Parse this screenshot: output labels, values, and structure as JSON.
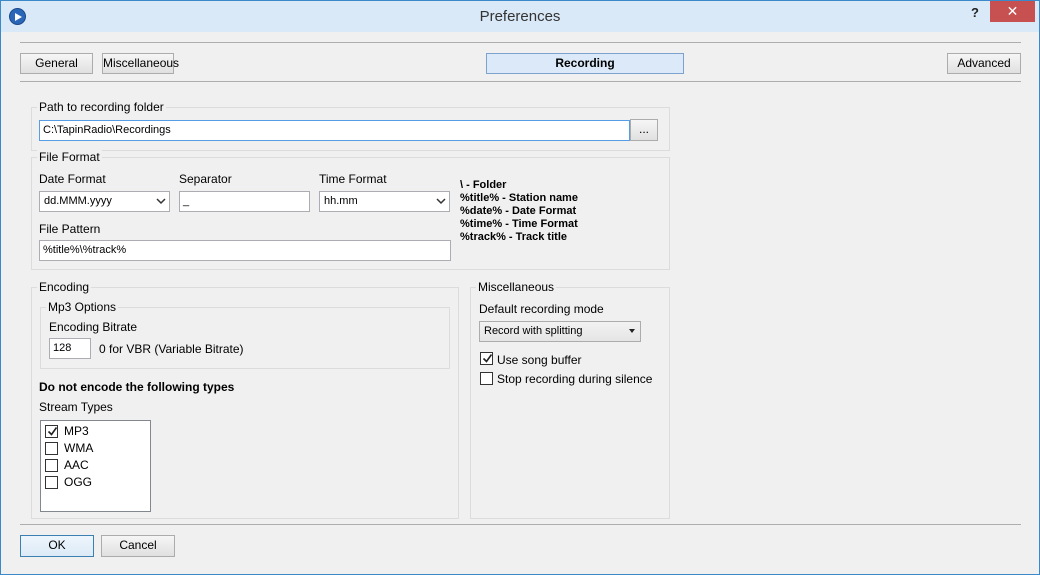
{
  "window": {
    "title": "Preferences",
    "help": "?",
    "close": "✕"
  },
  "tabs": [
    {
      "label": "General"
    },
    {
      "label": "Miscellaneous"
    },
    {
      "label": "Recording"
    },
    {
      "label": "Advanced"
    }
  ],
  "path": {
    "group_label": "Path to recording folder",
    "value": "C:\\TapinRadio\\Recordings",
    "browse": "..."
  },
  "file_format": {
    "group_label": "File Format",
    "date_format_label": "Date Format",
    "date_format_value": "dd.MMM.yyyy",
    "separator_label": "Separator",
    "separator_value": "_",
    "time_format_label": "Time Format",
    "time_format_value": "hh.mm",
    "file_pattern_label": "File Pattern",
    "file_pattern_value": "%title%\\%track%",
    "legend": [
      "\\ - Folder",
      "%title% - Station name",
      "%date% - Date Format",
      "%time% - Time Format",
      "%track% - Track title"
    ]
  },
  "encoding": {
    "group_label": "Encoding",
    "mp3_label": "Mp3 Options",
    "bitrate_label": "Encoding Bitrate",
    "bitrate_value": "128",
    "bitrate_hint": "0 for VBR (Variable Bitrate)",
    "no_encode_label": "Do not encode the following types",
    "stream_types_label": "Stream Types",
    "stream_types": [
      {
        "label": "MP3",
        "checked": true
      },
      {
        "label": "WMA",
        "checked": false
      },
      {
        "label": "AAC",
        "checked": false
      },
      {
        "label": "OGG",
        "checked": false
      }
    ]
  },
  "misc": {
    "group_label": "Miscellaneous",
    "mode_label": "Default recording mode",
    "mode_value": "Record with splitting",
    "song_buffer_label": "Use song buffer",
    "song_buffer_checked": true,
    "stop_silence_label": "Stop recording during silence",
    "stop_silence_checked": false
  },
  "footer": {
    "ok": "OK",
    "cancel": "Cancel"
  }
}
